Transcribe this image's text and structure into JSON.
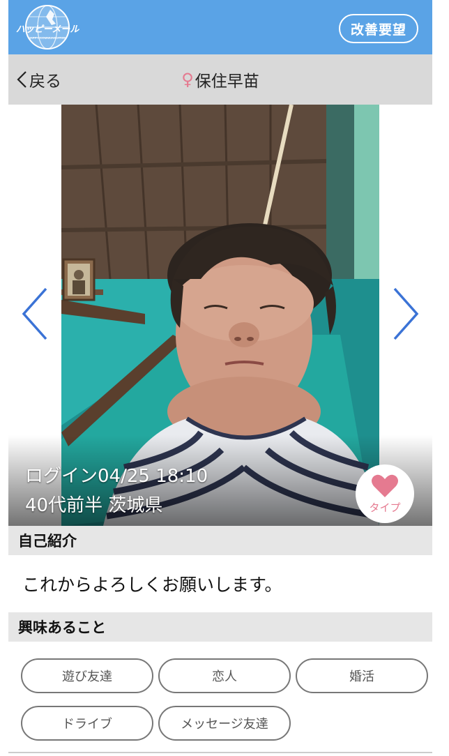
{
  "header": {
    "logo_icon": "globe-logo-icon",
    "logo_text": "ハッピーメール",
    "logo_subtext": "HAPPY COMMUNICATION",
    "improve_label": "改善要望",
    "bar_color": "#5aa3e6"
  },
  "nav": {
    "back_label": "戻る",
    "gender_icon": "♀",
    "name": "保住早苗"
  },
  "profile": {
    "login": "ログイン04/25 18:10",
    "age_region": "40代前半 茨城県",
    "type_label": "タイプ",
    "heart_color": "#e57a90"
  },
  "intro": {
    "header": "自己紹介",
    "body": "これからよろしくお願いします。"
  },
  "interests": {
    "header": "興味あること",
    "tags": [
      "遊び友達",
      "恋人",
      "婚活",
      "ドライブ",
      "メッセージ友達"
    ]
  }
}
